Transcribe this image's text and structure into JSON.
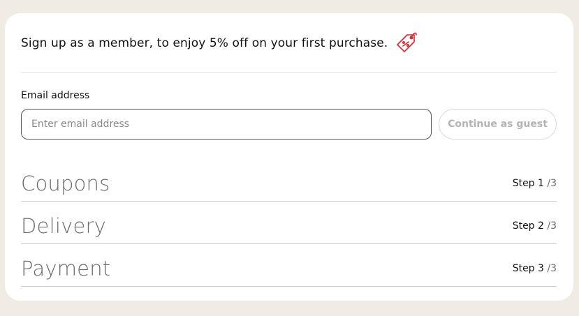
{
  "promo": {
    "text": "Sign up as a member, to enjoy 5% off on your first purchase.",
    "icon": "discount-tag-icon",
    "icon_color": "#e0242c"
  },
  "email": {
    "label": "Email address",
    "placeholder": "Enter email address",
    "value": ""
  },
  "guest_button": {
    "label": "Continue as guest"
  },
  "steps": [
    {
      "title": "Coupons",
      "step_label": "Step 1",
      "total": "/3"
    },
    {
      "title": "Delivery",
      "step_label": "Step 2",
      "total": "/3"
    },
    {
      "title": "Payment",
      "step_label": "Step 3",
      "total": "/3"
    }
  ],
  "colors": {
    "background": "#f0ece4",
    "card": "#ffffff",
    "accent": "#e0242c"
  }
}
